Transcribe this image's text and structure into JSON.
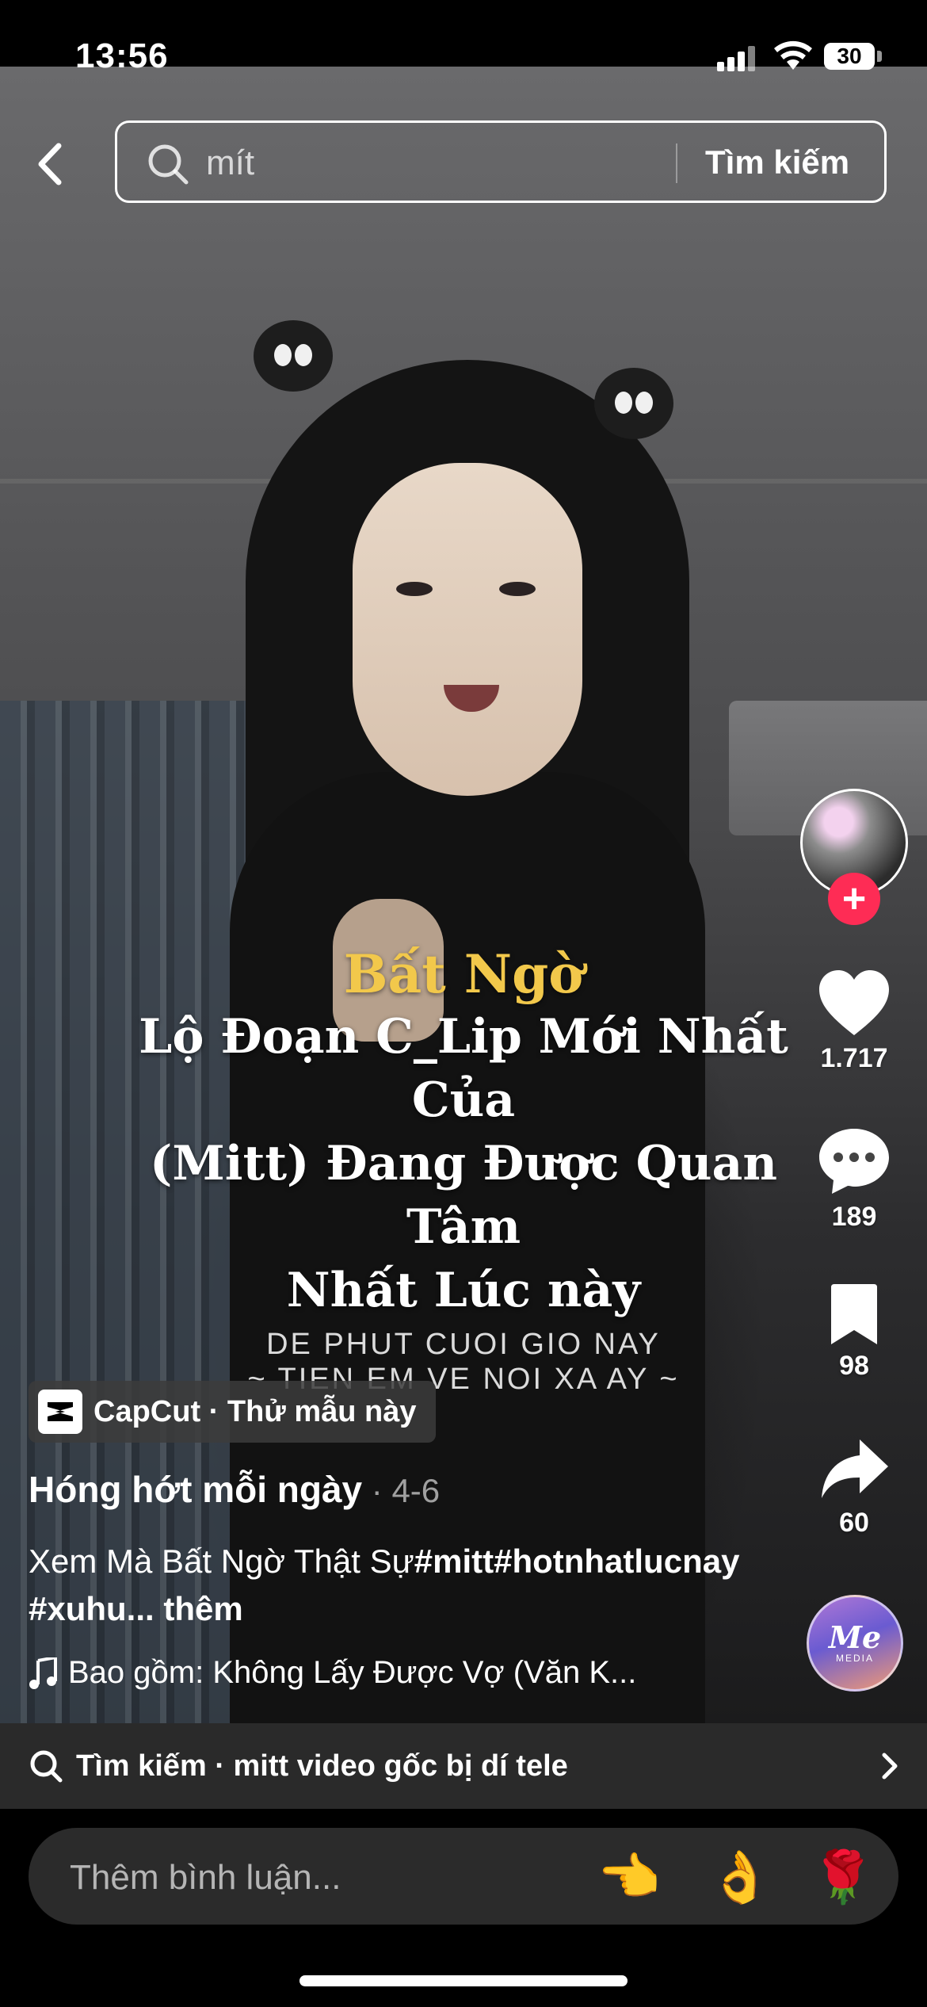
{
  "status_bar": {
    "time": "13:56",
    "battery": "30"
  },
  "header": {
    "search_value": "mít",
    "search_button": "Tìm kiếm"
  },
  "caption": {
    "highlight": "Bất Ngờ",
    "main": "Lộ Đoạn C_Lip Mới Nhất Của\n(Mitt) Đang Được Quan Tâm\nNhất Lúc này",
    "sub_line1": "DE PHUT CUOI GIO NAY",
    "sub_line2": "~ TIEN EM VE NOI XA AY ~"
  },
  "actions": {
    "likes": "1.717",
    "comments": "189",
    "saves": "98",
    "shares": "60",
    "follow": "+"
  },
  "music_disc": {
    "line1": "Me",
    "line2": "MEDIA"
  },
  "post": {
    "capcut_label": "CapCut · Thử mẫu này",
    "author": "Hóng hớt mỗi ngày",
    "date": " · 4-6",
    "description_text": "Xem Mà Bất Ngờ Thật Sự",
    "description_tags": "#mitt#hotnhatlucnay #xuhu...",
    "description_more": " thêm",
    "music": "Bao gồm: Không Lấy Được Vợ (Văn K..."
  },
  "related_search": {
    "label": "Tìm kiếm · mitt video gốc bị dí tele"
  },
  "comment": {
    "placeholder": "Thêm bình luận...",
    "emojis": [
      "👈",
      "👌",
      "🌹"
    ]
  }
}
